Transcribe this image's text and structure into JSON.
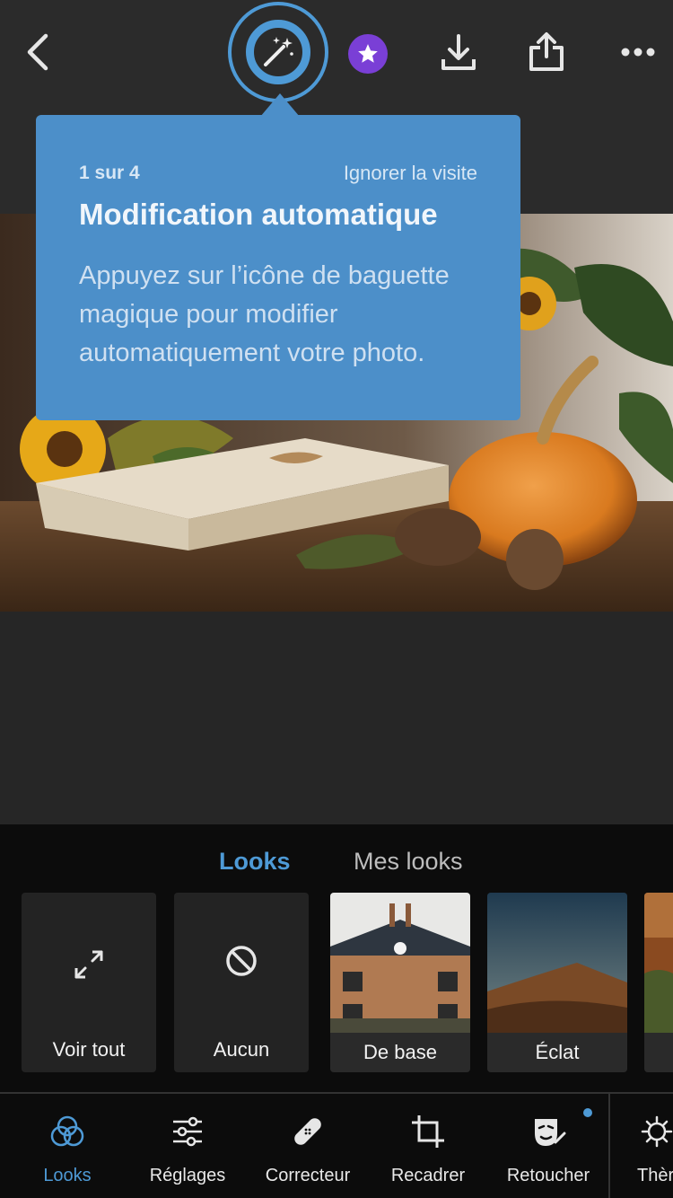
{
  "topbar": {
    "icons": [
      "back-icon",
      "magic-wand-icon",
      "premium-star-icon",
      "download-icon",
      "share-icon",
      "more-icon"
    ]
  },
  "tooltip": {
    "step": "1 sur 4",
    "skip": "Ignorer la visite",
    "title": "Modification automatique",
    "body_line1": "Appuyez sur l’icône de baguette",
    "body_line2": "magique pour modifier",
    "body_line3": "automatiquement votre photo."
  },
  "panel": {
    "tabs": [
      {
        "label": "Looks",
        "active": true
      },
      {
        "label": "Mes looks",
        "active": false
      }
    ],
    "cards": [
      {
        "label": "Voir tout",
        "icon": "expand-icon"
      },
      {
        "label": "Aucun",
        "icon": "none-icon"
      },
      {
        "label": "De base"
      },
      {
        "label": "Éclat"
      }
    ]
  },
  "toolbar": {
    "items": [
      {
        "label": "Looks",
        "icon": "looks-icon",
        "active": true
      },
      {
        "label": "Réglages",
        "icon": "sliders-icon"
      },
      {
        "label": "Correcteur",
        "icon": "bandage-icon"
      },
      {
        "label": "Recadrer",
        "icon": "crop-icon"
      },
      {
        "label": "Retoucher",
        "icon": "retouch-icon"
      },
      {
        "label": "Thèr",
        "icon": "theme-icon"
      }
    ]
  },
  "colors": {
    "accent": "#4e9ad6",
    "tooltip_bg": "#4c8fc9",
    "premium": "#7a3fd6",
    "background": "#262626"
  }
}
